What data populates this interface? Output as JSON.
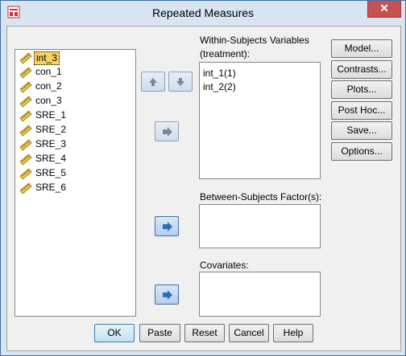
{
  "window": {
    "title": "Repeated Measures",
    "close_glyph": "✕"
  },
  "source_list": {
    "items": [
      {
        "label": "int_3",
        "selected": true
      },
      {
        "label": "con_1",
        "selected": false
      },
      {
        "label": "con_2",
        "selected": false
      },
      {
        "label": "con_3",
        "selected": false
      },
      {
        "label": "SRE_1",
        "selected": false
      },
      {
        "label": "SRE_2",
        "selected": false
      },
      {
        "label": "SRE_3",
        "selected": false
      },
      {
        "label": "SRE_4",
        "selected": false
      },
      {
        "label": "SRE_5",
        "selected": false
      },
      {
        "label": "SRE_6",
        "selected": false
      }
    ]
  },
  "within": {
    "label_line1": "Within-Subjects Variables",
    "label_line2": "(treatment):",
    "items": [
      "int_1(1)",
      "int_2(2)"
    ]
  },
  "between": {
    "label": "Between-Subjects Factor(s):"
  },
  "covariates": {
    "label": "Covariates:"
  },
  "side_buttons": {
    "model": "Model...",
    "contrasts": "Contrasts...",
    "plots": "Plots...",
    "post_hoc": "Post Hoc...",
    "save": "Save...",
    "options": "Options..."
  },
  "bottom_buttons": {
    "ok": "OK",
    "paste": "Paste",
    "reset": "Reset",
    "cancel": "Cancel",
    "help": "Help"
  },
  "colors": {
    "selection": "#f8d466",
    "arrow_blue": "#2e6fb8",
    "arrow_gray": "#7a8896"
  }
}
